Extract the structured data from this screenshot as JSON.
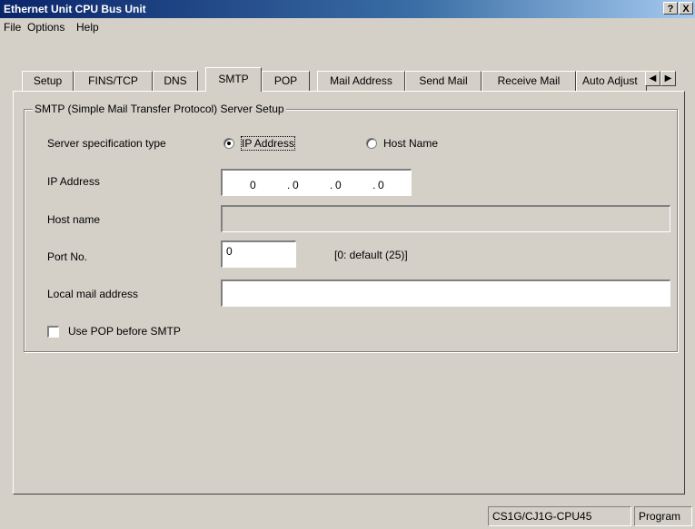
{
  "window": {
    "title": "Ethernet Unit CPU Bus Unit",
    "help_button": "?",
    "close_button": "X"
  },
  "menu": {
    "items": [
      "File",
      "Options",
      "Help"
    ]
  },
  "tabs": {
    "items": [
      "Setup",
      "FINS/TCP",
      "DNS",
      "SMTP",
      "POP",
      "Mail Address",
      "Send Mail",
      "Receive Mail",
      "Auto Adjust"
    ],
    "active": "SMTP",
    "scroll_left": "◀",
    "scroll_right": "▶"
  },
  "smtp": {
    "group_title": "SMTP (Simple Mail Transfer Protocol) Server Setup",
    "server_spec_label": "Server specification type",
    "radio_ip_label": "IP Address",
    "radio_host_label": "Host Name",
    "selected_spec": "IP Address",
    "ip_label": "IP Address",
    "ip_octets": [
      "0",
      "0",
      "0",
      "0"
    ],
    "ip_separator": ".",
    "host_label": "Host name",
    "host_value": "",
    "port_label": "Port No.",
    "port_value": "0",
    "port_hint": "[0: default (25)]",
    "local_mail_label": "Local mail address",
    "local_mail_value": "",
    "pop_before_smtp_label": "Use POP before SMTP",
    "pop_before_smtp_checked": false
  },
  "status": {
    "model": "CS1G/CJ1G-CPU45",
    "mode": "Program"
  }
}
